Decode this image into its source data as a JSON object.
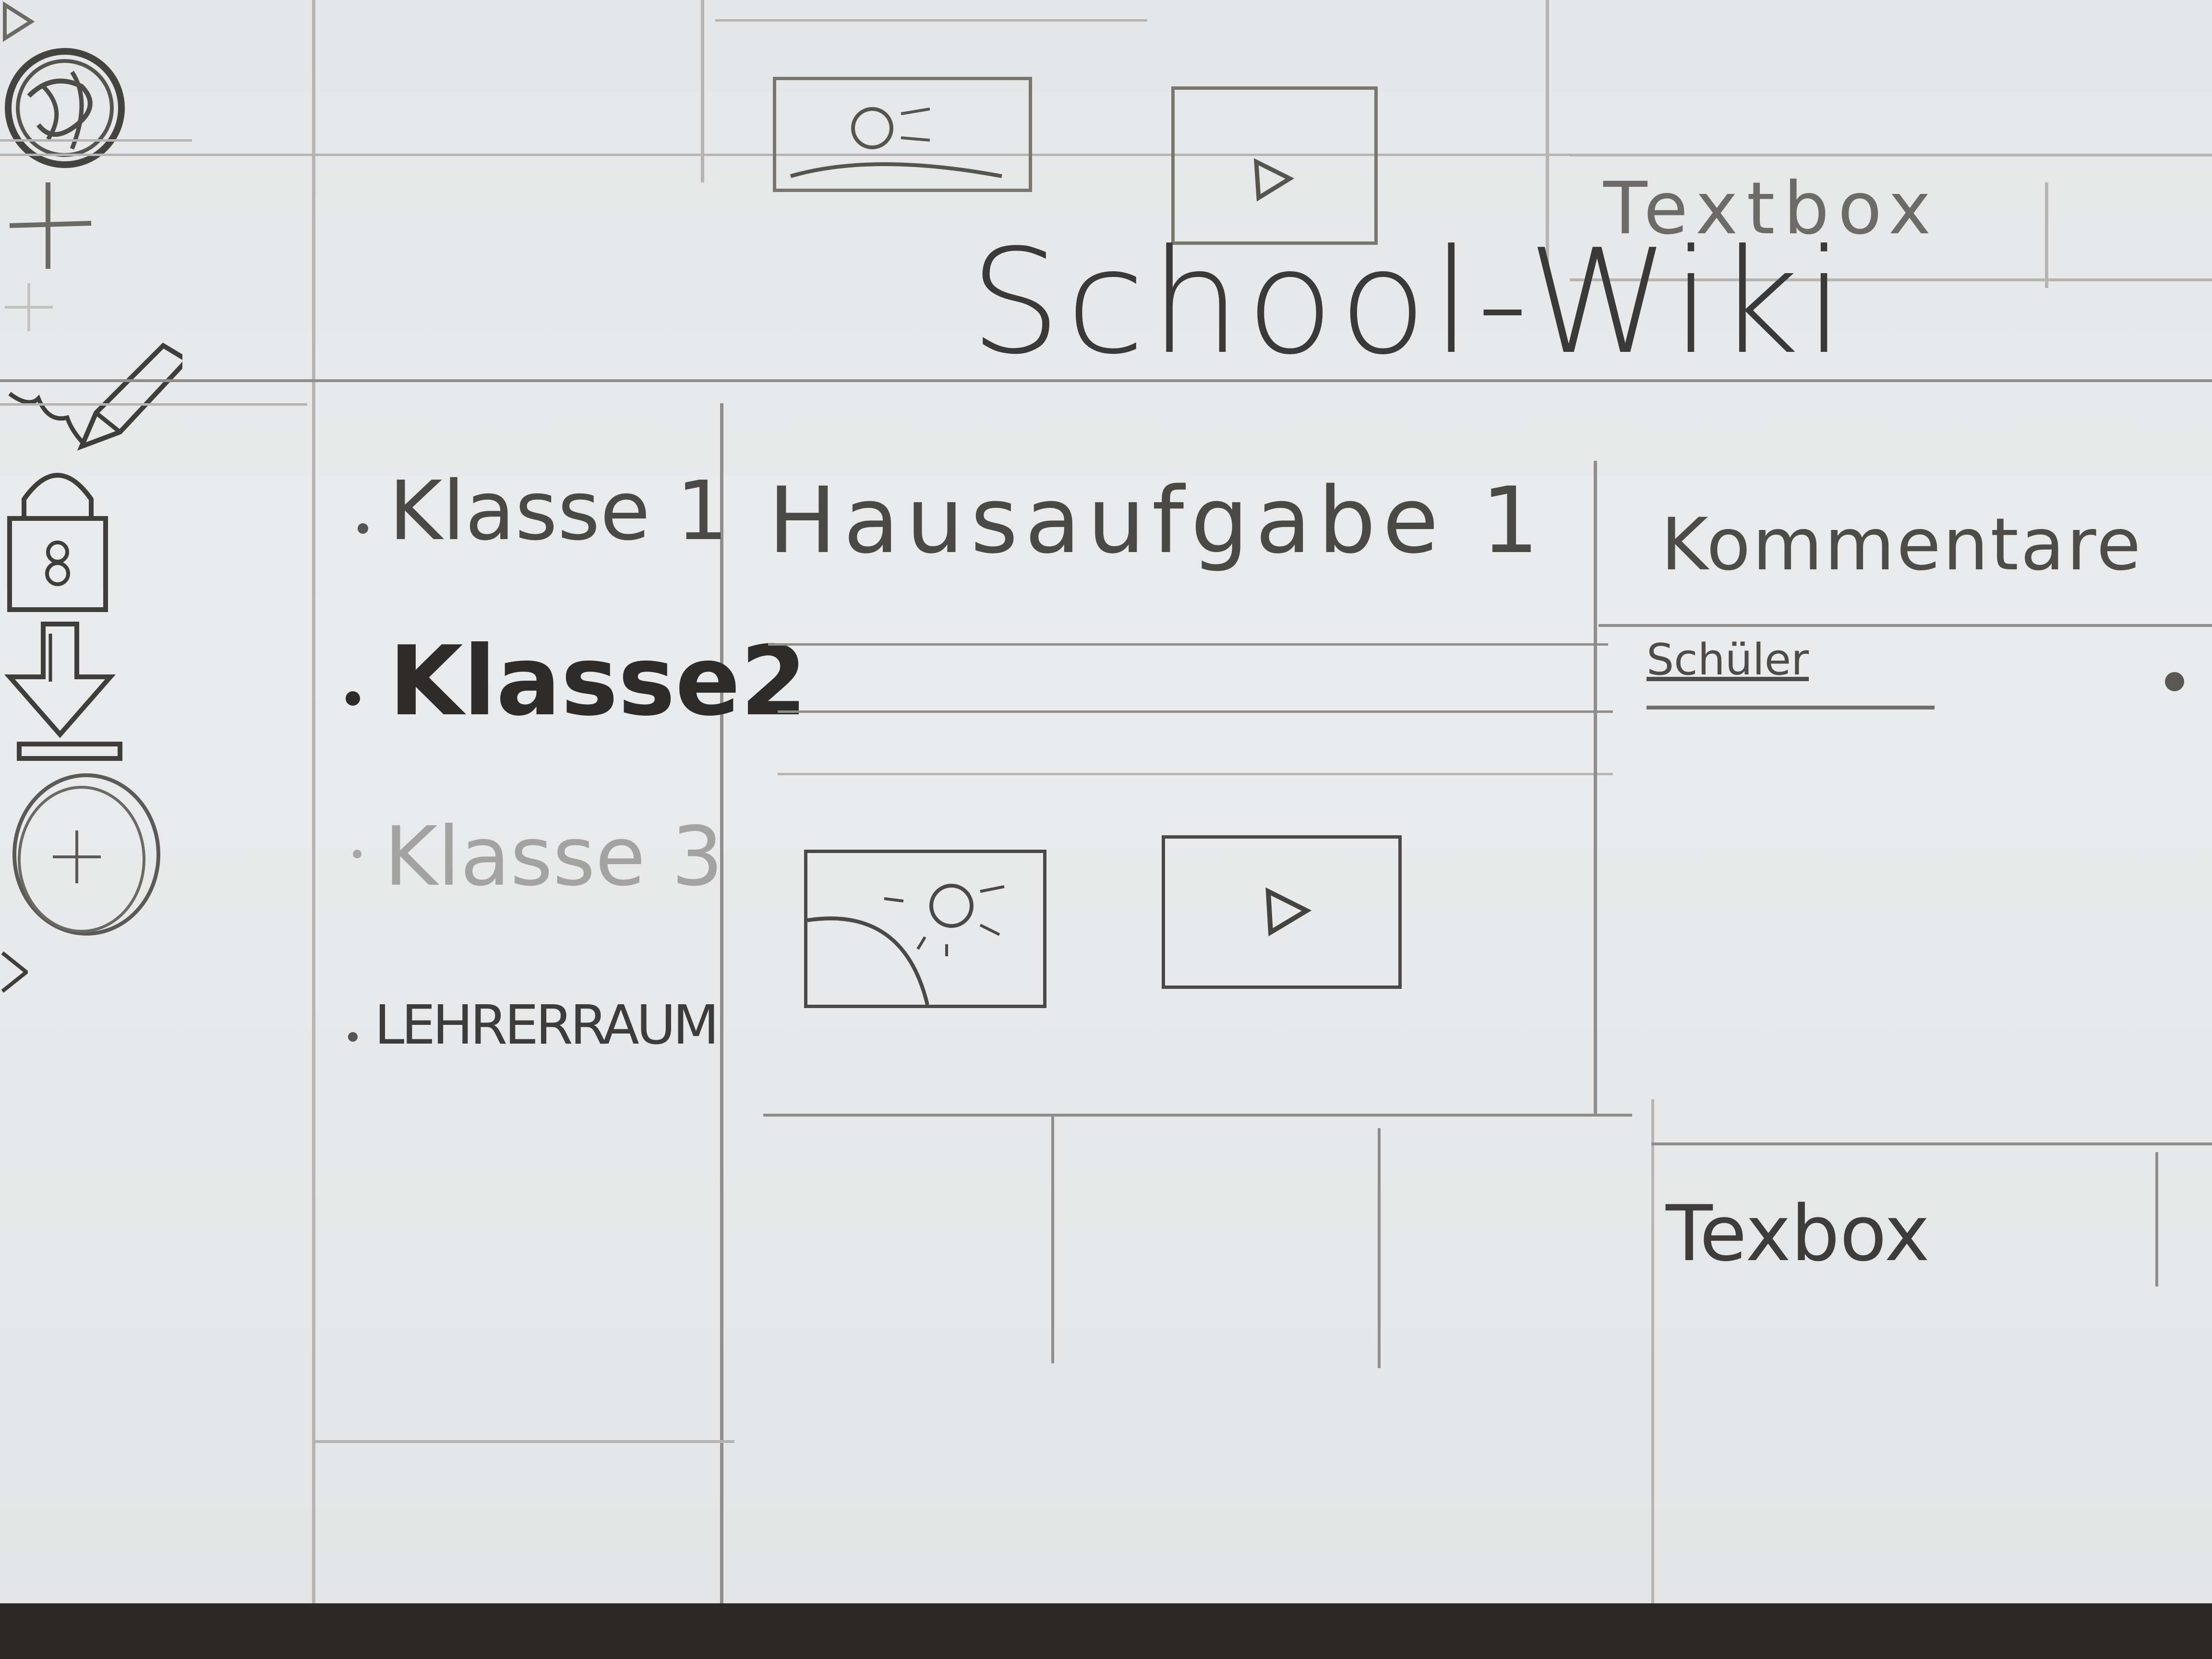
{
  "header": {
    "title": "School-Wiki"
  },
  "sidebar": {
    "items": [
      {
        "label": "Klasse 1",
        "state": "normal"
      },
      {
        "label": "Klasse2",
        "state": "selected"
      },
      {
        "label": "Klasse 3",
        "state": "disabled"
      },
      {
        "label": "LEHRERRAUM",
        "state": "normal"
      }
    ],
    "add_icon": "plus-icon"
  },
  "main": {
    "assignment_title": "Hausaufgabe 1",
    "media": [
      {
        "icon": "image-icon"
      },
      {
        "icon": "play-icon"
      }
    ],
    "toolbar": [
      {
        "icon": "pencil-icon"
      },
      {
        "icon": "lock-icon"
      },
      {
        "icon": "download-icon"
      }
    ]
  },
  "comments": {
    "title": "Kommentare",
    "add_icon": "plus-icon",
    "author": "Schüler",
    "input_placeholder": "Texbox",
    "send_icon": "send-icon"
  },
  "background_sheet": {
    "input_placeholder": "Textbox",
    "media": [
      {
        "icon": "image-icon"
      },
      {
        "icon": "play-icon"
      }
    ],
    "send_icon": "send-icon"
  }
}
